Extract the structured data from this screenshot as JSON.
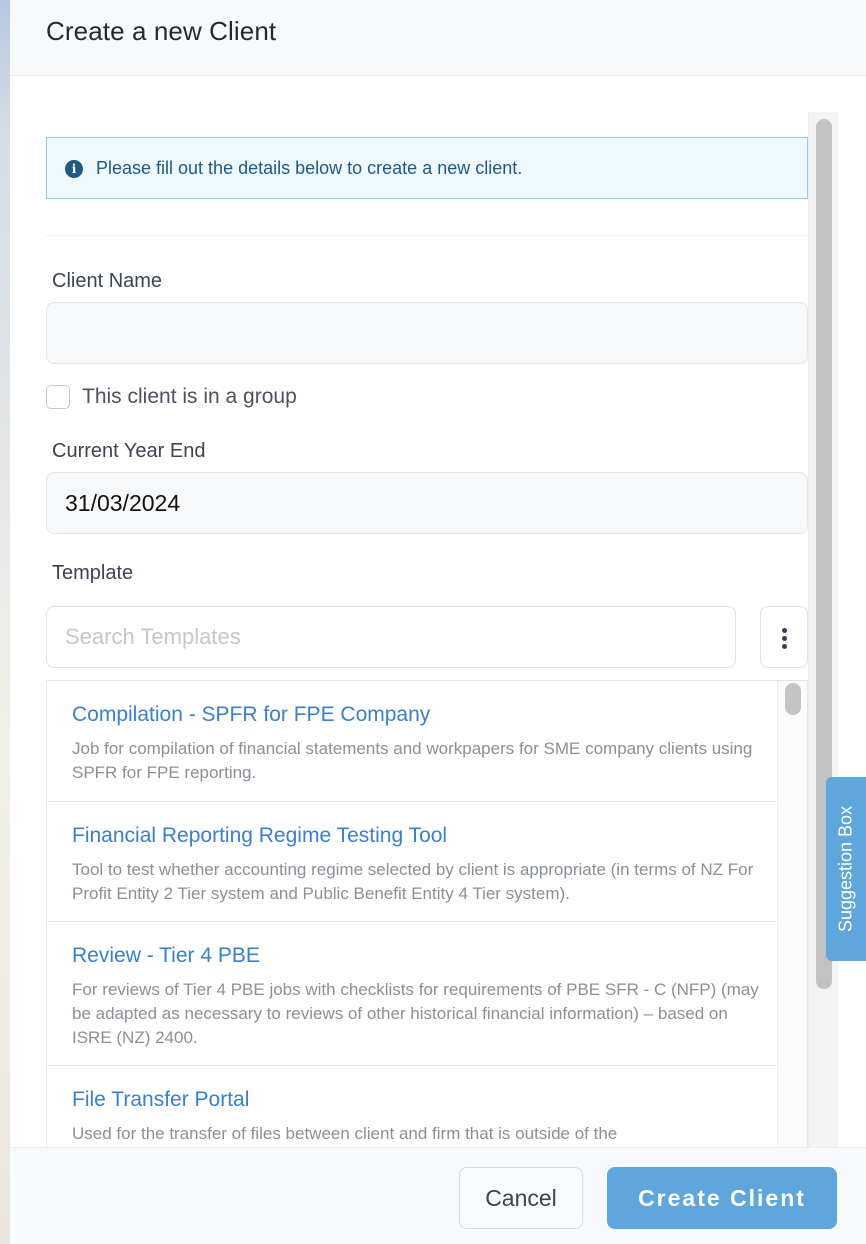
{
  "modal": {
    "title": "Create a new Client"
  },
  "info_alert": {
    "icon": "info-icon",
    "text": "Please fill out the details below to create a new client."
  },
  "form": {
    "client_name": {
      "label": "Client Name",
      "value": "",
      "placeholder": ""
    },
    "group_checkbox": {
      "label": "This client is in a group",
      "checked": false
    },
    "year_end": {
      "label": "Current Year End",
      "value": "31/03/2024"
    },
    "template": {
      "label": "Template",
      "search_placeholder": "Search Templates",
      "more_icon": "more-vertical-icon"
    }
  },
  "templates": [
    {
      "title": "Compilation - SPFR for FPE Company",
      "description": "Job for compilation of financial statements and workpapers for SME company clients using SPFR for FPE reporting."
    },
    {
      "title": "Financial Reporting Regime Testing Tool",
      "description": "Tool to test whether accounting regime selected by client is appropriate (in terms of NZ For Profit Entity 2 Tier system and Public Benefit Entity 4 Tier system)."
    },
    {
      "title": "Review - Tier 4 PBE",
      "description": "For reviews of Tier 4 PBE jobs with checklists for requirements of PBE SFR - C (NFP) (may be adapted as necessary to reviews of other historical financial information) – based on ISRE (NZ) 2400."
    },
    {
      "title": "File Transfer Portal",
      "description": "Used for the transfer of files between client and firm that is outside of the"
    }
  ],
  "suggestion_box": {
    "label": "Suggestion Box"
  },
  "footer": {
    "cancel_label": "Cancel",
    "create_label": "Create Client"
  },
  "colors": {
    "accent": "#5ea6dc",
    "link": "#3a7fd0",
    "info_text": "#1f5a84",
    "info_bg": "#eff8fd"
  }
}
